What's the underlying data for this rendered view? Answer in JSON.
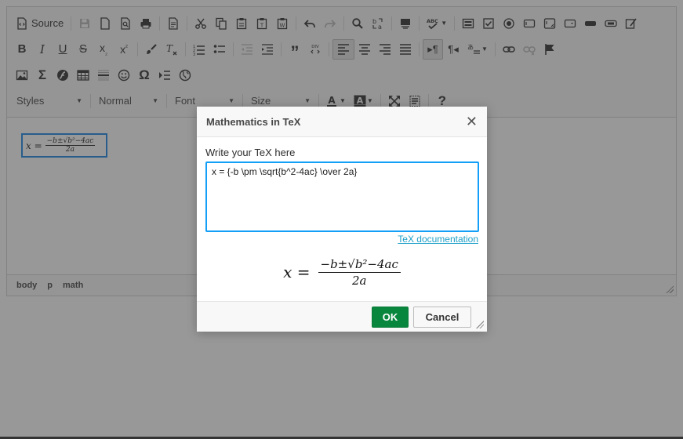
{
  "toolbar": {
    "source_label": "Source",
    "styles_label": "Styles",
    "format_label": "Normal",
    "font_label": "Font",
    "size_label": "Size"
  },
  "content": {
    "formula_lhs": "x =",
    "formula_numerator": "−b±√b²−4ac",
    "formula_denominator": "2a"
  },
  "statusbar": {
    "crumbs": [
      "body",
      "p",
      "math"
    ]
  },
  "dialog": {
    "title": "Mathematics in TeX",
    "close_glyph": "✕",
    "field_label": "Write your TeX here",
    "tex_value": "x = {-b \\pm \\sqrt{b^2-4ac} \\over 2a}",
    "doc_link": "TeX documentation",
    "preview_lhs": "x =",
    "preview_numerator": "−b±√b²−4ac",
    "preview_denominator": "2a",
    "ok_label": "OK",
    "cancel_label": "Cancel"
  },
  "colors": {
    "accent_blue": "#139ff7",
    "ok_green": "#09863e",
    "link": "#1ea0c8"
  }
}
